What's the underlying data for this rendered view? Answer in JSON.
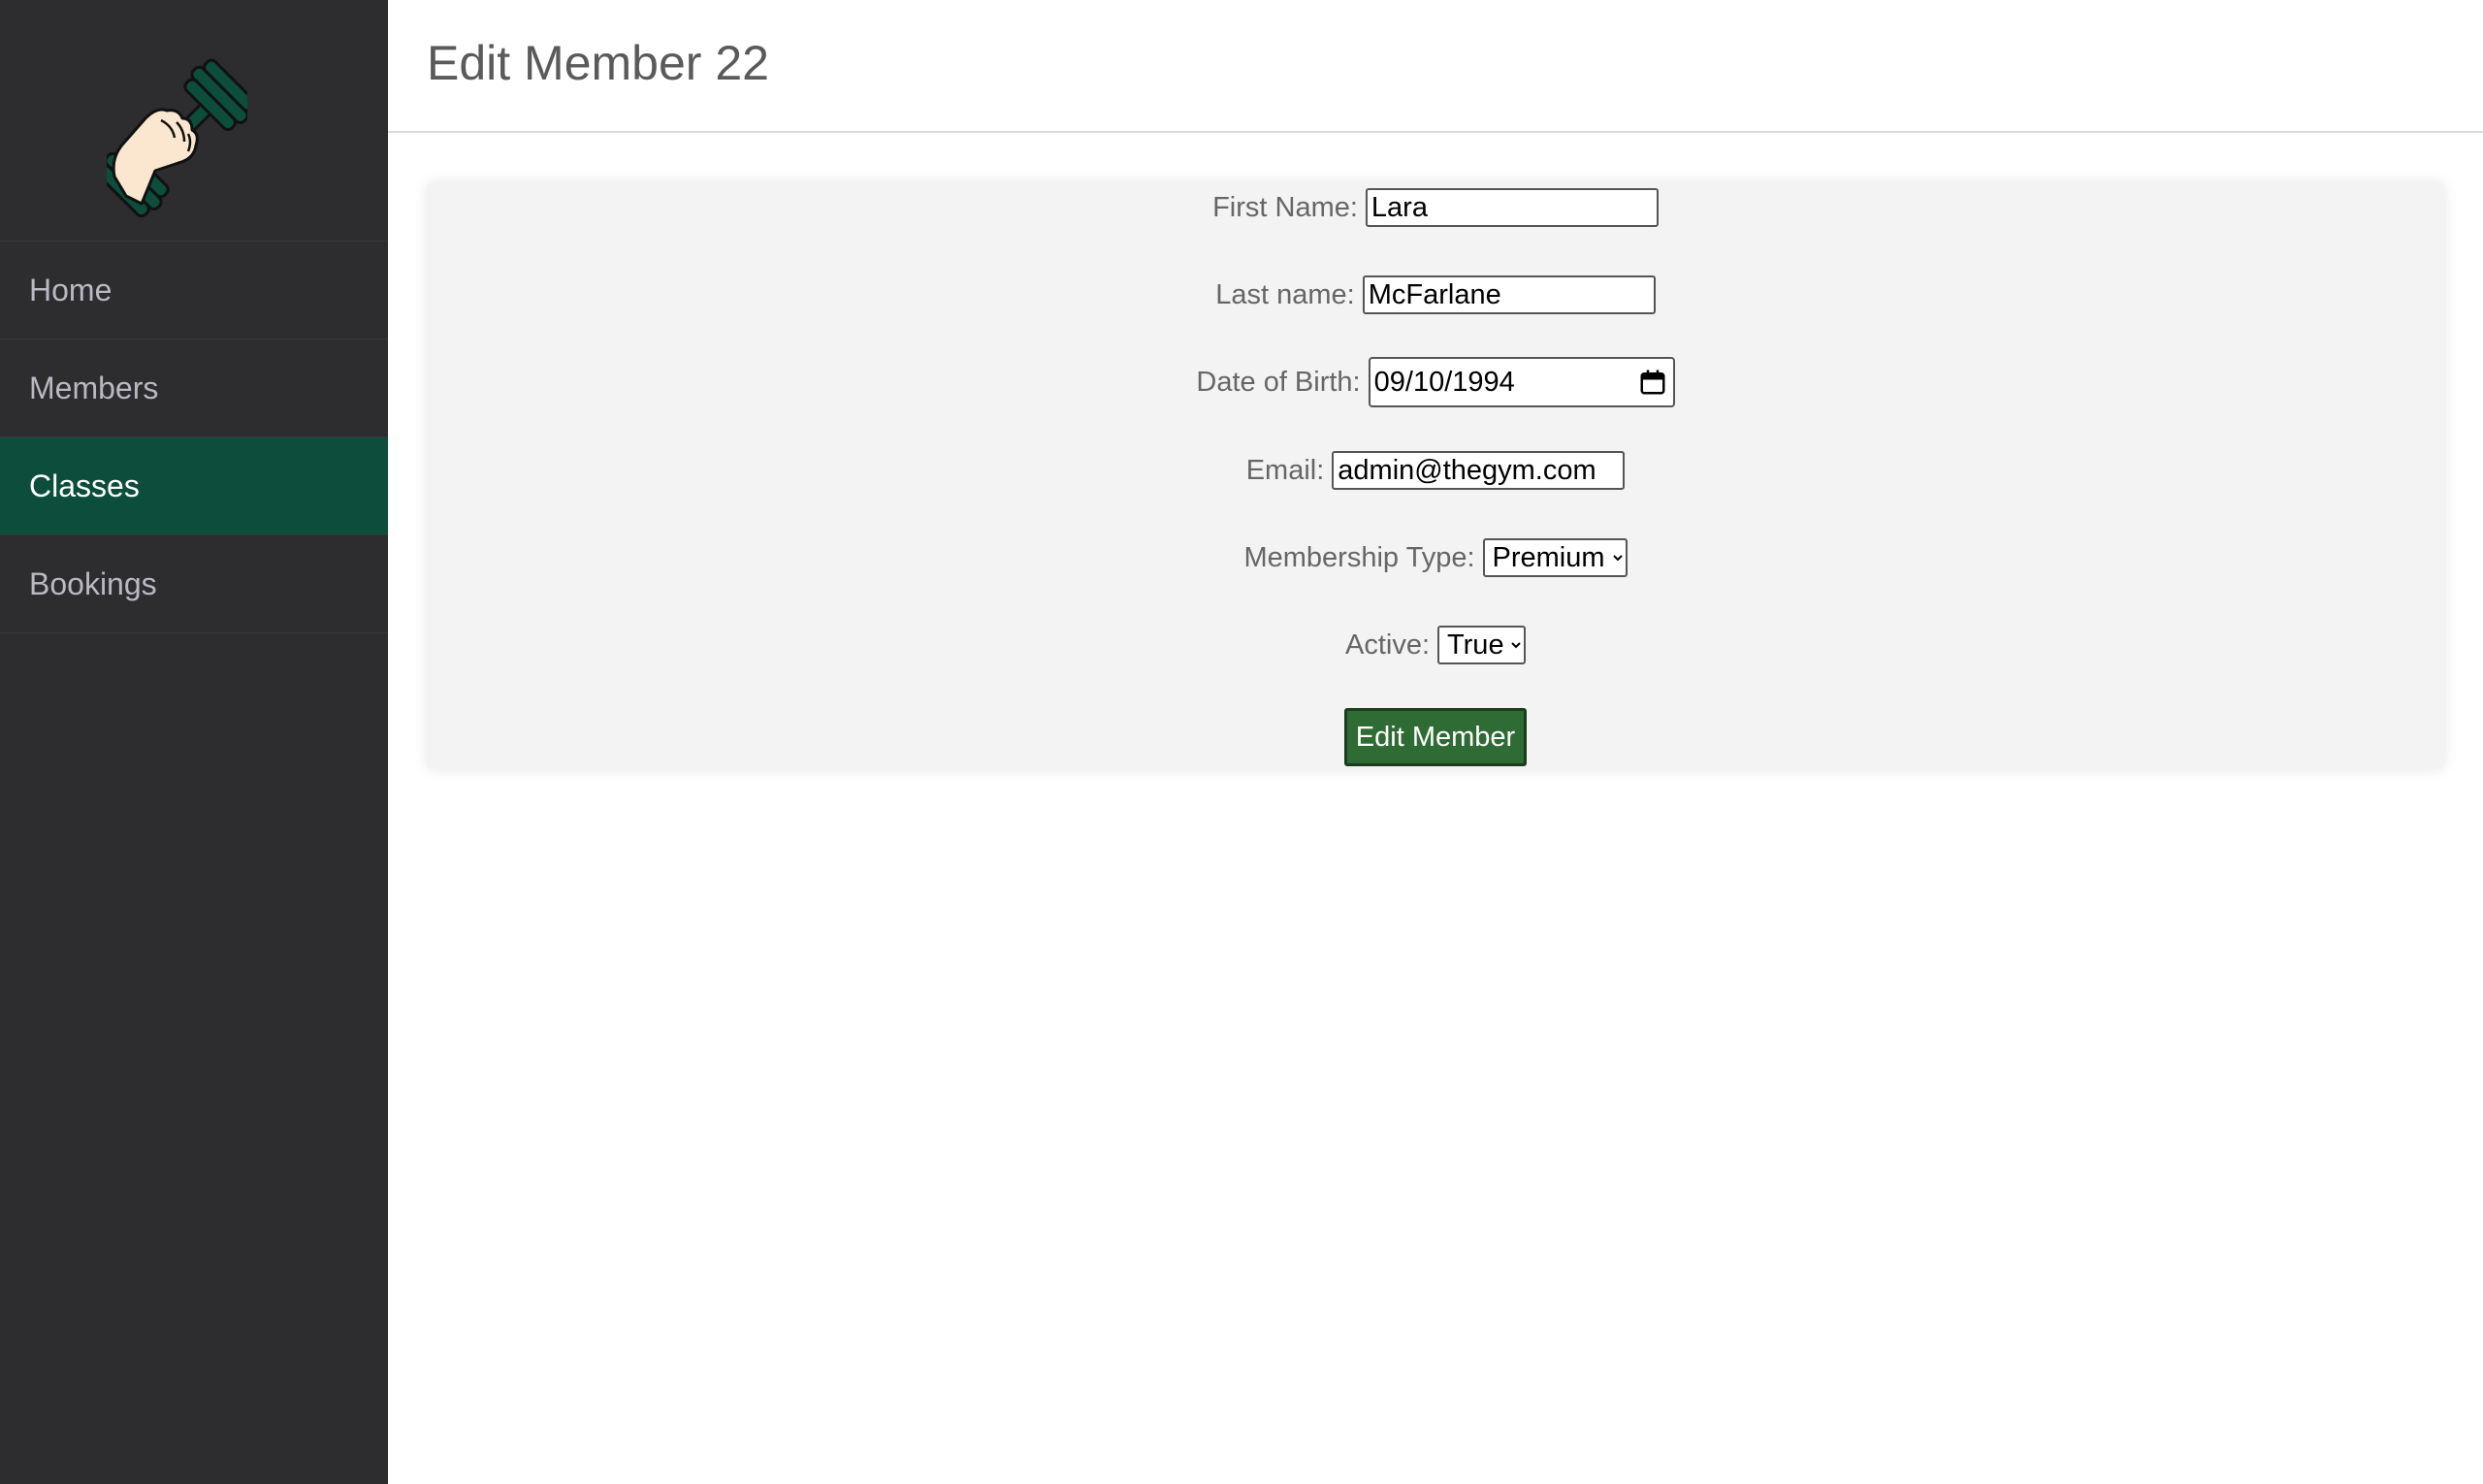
{
  "header": {
    "title": "Edit Member 22"
  },
  "sidebar": {
    "items": [
      {
        "label": "Home"
      },
      {
        "label": "Members"
      },
      {
        "label": "Classes"
      },
      {
        "label": "Bookings"
      }
    ],
    "active_item": "Classes"
  },
  "form": {
    "first_name_label": "First Name:",
    "first_name_value": "Lara",
    "last_name_label": "Last name:",
    "last_name_value": "McFarlane",
    "dob_label": "Date of Birth:",
    "dob_value": "09/10/1994",
    "email_label": "Email:",
    "email_value": "admin@thegym.com",
    "membership_label": "Membership Type:",
    "membership_value": "Premium",
    "active_label": "Active:",
    "active_value": "True",
    "submit_label": "Edit Member"
  },
  "colors": {
    "sidebar_bg": "#2d2d2f",
    "active_nav_bg": "#0d4d3c",
    "button_bg": "#2f6b35",
    "logo_green": "#0d4d3c"
  },
  "icons": {
    "logo": "dumbbell-hand-icon",
    "date_picker": "calendar-icon"
  }
}
